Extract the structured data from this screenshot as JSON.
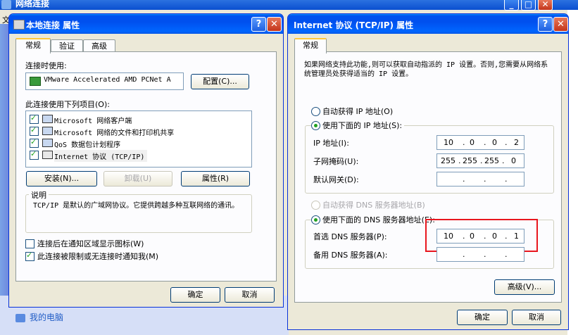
{
  "background_window": {
    "title": "网络连接",
    "menu_partial": "文",
    "sidebar_item": "我的电脑"
  },
  "adapter_dialog": {
    "title": "本地连接 属性",
    "tabs": [
      "常规",
      "验证",
      "高级"
    ],
    "connect_using_label": "连接时使用:",
    "adapter_name": "VMware Accelerated AMD PCNet A",
    "configure_button": "配置(C)...",
    "items_label": "此连接使用下列项目(O):",
    "items": [
      {
        "label": "Microsoft 网络客户端",
        "checked": true
      },
      {
        "label": "Microsoft 网络的文件和打印机共享",
        "checked": true
      },
      {
        "label": "QoS 数据包计划程序",
        "checked": true
      },
      {
        "label": "Internet 协议 (TCP/IP)",
        "checked": true,
        "selected": true
      }
    ],
    "install_button": "安装(N)...",
    "uninstall_button": "卸载(U)",
    "properties_button": "属性(R)",
    "description_legend": "说明",
    "description_text": "TCP/IP 是默认的广域网协议。它提供跨越多种互联网络的通讯。",
    "show_icon_label": "连接后在通知区域显示图标(W)",
    "show_icon_checked": false,
    "notify_label": "此连接被限制或无连接时通知我(M)",
    "notify_checked": true,
    "ok_button": "确定",
    "cancel_button": "取消"
  },
  "tcpip_dialog": {
    "title": "Internet 协议 (TCP/IP) 属性",
    "tab": "常规",
    "intro": "如果网络支持此功能,则可以获取自动指派的 IP 设置。否则,您需要从网络系统管理员处获得适当的 IP 设置。",
    "auto_ip_label": "自动获得 IP 地址(O)",
    "manual_ip_label": "使用下面的 IP 地址(S):",
    "ip_label": "IP 地址(I):",
    "ip_value": [
      "10",
      "0",
      "0",
      "2"
    ],
    "mask_label": "子网掩码(U):",
    "mask_value": [
      "255",
      "255",
      "255",
      "0"
    ],
    "gateway_label": "默认网关(D):",
    "gateway_value": [
      "",
      "",
      "",
      ""
    ],
    "auto_dns_label": "自动获得 DNS 服务器地址(B)",
    "manual_dns_label": "使用下面的 DNS 服务器地址(E):",
    "dns1_label": "首选 DNS 服务器(P):",
    "dns1_value": [
      "10",
      "0",
      "0",
      "1"
    ],
    "dns2_label": "备用 DNS 服务器(A):",
    "dns2_value": [
      "",
      "",
      "",
      ""
    ],
    "advanced_button": "高级(V)...",
    "ok_button": "确定",
    "cancel_button": "取消",
    "highlight_color": "#e8161e"
  }
}
